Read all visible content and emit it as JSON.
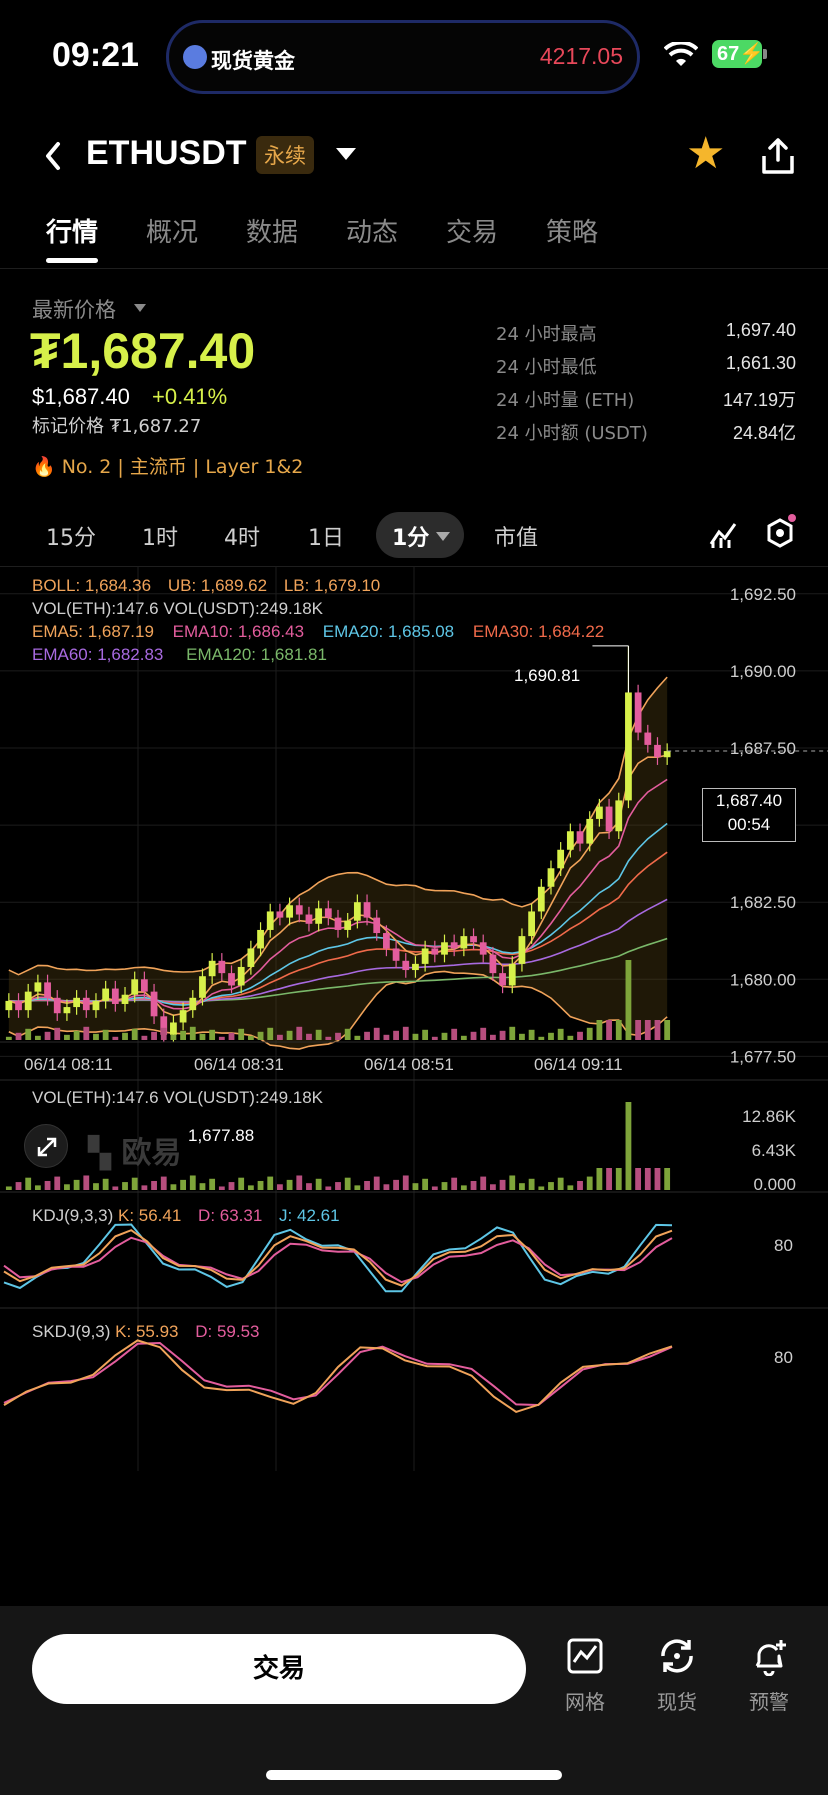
{
  "status": {
    "time": "09:21",
    "battery": "67",
    "island_label": "现货黄金",
    "island_price": "4217.05"
  },
  "header": {
    "symbol": "ETHUSDT",
    "badge": "永续"
  },
  "tabs": [
    "行情",
    "概况",
    "数据",
    "动态",
    "交易",
    "策略"
  ],
  "price": {
    "label": "最新价格",
    "last": "₮1,687.40",
    "usd": "$1,687.40",
    "change": "+0.41%",
    "mark": "标记价格 ₮1,687.27",
    "tags": "No. 2  |  主流币  |  Layer 1&2"
  },
  "stats": [
    {
      "k": "24 小时最高",
      "v": "1,697.40"
    },
    {
      "k": "24 小时最低",
      "v": "1,661.30"
    },
    {
      "k": "24 小时量 (ETH)",
      "v": "147.19万"
    },
    {
      "k": "24 小时额 (USDT)",
      "v": "24.84亿"
    }
  ],
  "intervals": [
    "15分",
    "1时",
    "4时",
    "1日",
    "1分",
    "市值"
  ],
  "indicators": {
    "boll": "BOLL: 1,684.36",
    "ub": "UB: 1,689.62",
    "lb": "LB: 1,679.10",
    "vol": "VOL(ETH):147.6  VOL(USDT):249.18K",
    "ema5": "EMA5: 1,687.19",
    "ema10": "EMA10: 1,686.43",
    "ema20": "EMA20: 1,685.08",
    "ema30": "EMA30: 1,684.22",
    "ema60": "EMA60: 1,682.83",
    "ema120": "EMA120: 1,681.81",
    "high_marker": "1,690.81",
    "low_marker": "1,677.88",
    "current_price": "1,687.40",
    "countdown": "00:54",
    "watermark": "欧易"
  },
  "chart_data": {
    "type": "candlestick",
    "interval": "1分",
    "y_ticks": [
      "1,692.50",
      "1,690.00",
      "1,687.50",
      "1,685.00",
      "1,682.50",
      "1,680.00",
      "1,677.50"
    ],
    "ylim": [
      1676.8,
      1693.4
    ],
    "x_ticks": [
      "06/14 08:11",
      "06/14 08:31",
      "06/14 08:51",
      "06/14 09:11"
    ],
    "high": 1690.81,
    "low": 1677.88,
    "last": 1687.4,
    "ub": 1689.62,
    "boll": 1684.36,
    "lb": 1679.1,
    "closes": [
      1679.3,
      1679.0,
      1679.6,
      1679.9,
      1679.4,
      1678.9,
      1679.1,
      1679.4,
      1679.0,
      1679.3,
      1679.7,
      1679.2,
      1679.5,
      1680.0,
      1679.6,
      1678.8,
      1678.2,
      1678.6,
      1679.0,
      1679.4,
      1680.1,
      1680.6,
      1680.2,
      1679.8,
      1680.4,
      1681.0,
      1681.6,
      1682.2,
      1682.0,
      1682.4,
      1682.1,
      1681.8,
      1682.3,
      1682.0,
      1681.6,
      1681.9,
      1682.5,
      1682.0,
      1681.5,
      1681.0,
      1680.6,
      1680.3,
      1680.5,
      1681.0,
      1680.8,
      1681.2,
      1681.0,
      1681.4,
      1681.2,
      1680.8,
      1680.2,
      1679.8,
      1680.5,
      1681.4,
      1682.2,
      1683.0,
      1683.6,
      1684.2,
      1684.8,
      1684.4,
      1685.2,
      1685.6,
      1684.8,
      1685.8,
      1689.3,
      1688.0,
      1687.6,
      1687.2,
      1687.4
    ],
    "volume_ticks": [
      "12.86K",
      "6.43K",
      "0.000"
    ],
    "volume_header": "VOL(ETH):147.6  VOL(USDT):249.18K",
    "kdj": {
      "label": "KDJ(9,3,3)",
      "k": "K: 56.41",
      "d": "D: 63.31",
      "j": "J: 42.61",
      "tick": "80"
    },
    "skdj": {
      "label": "SKDJ(9,3)",
      "k": "K: 55.93",
      "d": "D: 59.53",
      "tick": "80"
    }
  },
  "colors": {
    "up": "#d7f04a",
    "down": "#e35d9d",
    "ub": "#f0a35a",
    "lb": "#f0a35a",
    "ema5": "#f0a35a",
    "ema10": "#e35d9d",
    "ema20": "#5ec6e6",
    "ema30": "#f06a4a",
    "ema60": "#a86ae0",
    "ema120": "#7ab86a"
  },
  "bottom": {
    "trade": "交易",
    "tools": [
      "网格",
      "现货",
      "预警"
    ]
  }
}
